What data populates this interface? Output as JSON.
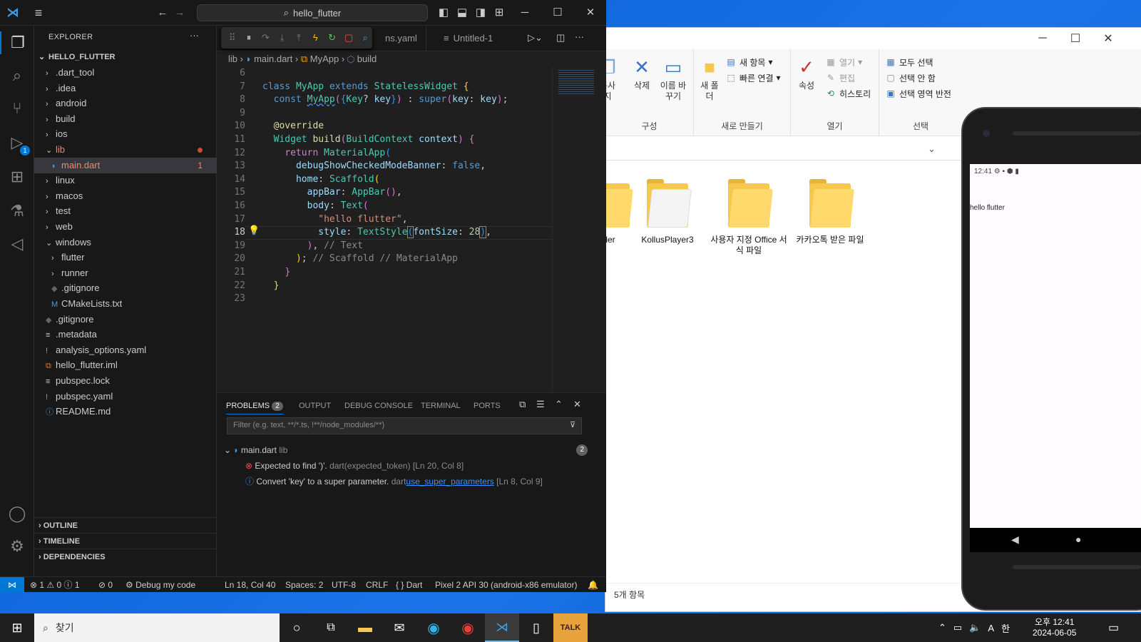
{
  "vscode": {
    "search_text": "hello_flutter",
    "explorer_title": "EXPLORER",
    "project": "HELLO_FLUTTER",
    "tree": [
      {
        "label": ".dart_tool",
        "type": "folder",
        "depth": 1,
        "open": false
      },
      {
        "label": ".idea",
        "type": "folder",
        "depth": 1,
        "open": false
      },
      {
        "label": "android",
        "type": "folder",
        "depth": 1,
        "open": false
      },
      {
        "label": "build",
        "type": "folder",
        "depth": 1,
        "open": false
      },
      {
        "label": "ios",
        "type": "folder",
        "depth": 1,
        "open": false
      },
      {
        "label": "lib",
        "type": "folder",
        "depth": 1,
        "open": true,
        "error": true
      },
      {
        "label": "main.dart",
        "type": "dart",
        "depth": 2,
        "selected": true,
        "badge": "1"
      },
      {
        "label": "linux",
        "type": "folder",
        "depth": 1,
        "open": false
      },
      {
        "label": "macos",
        "type": "folder",
        "depth": 1,
        "open": false
      },
      {
        "label": "test",
        "type": "folder",
        "depth": 1,
        "open": false
      },
      {
        "label": "web",
        "type": "folder",
        "depth": 1,
        "open": false
      },
      {
        "label": "windows",
        "type": "folder",
        "depth": 1,
        "open": true
      },
      {
        "label": "flutter",
        "type": "folder",
        "depth": 2,
        "open": false
      },
      {
        "label": "runner",
        "type": "folder",
        "depth": 2,
        "open": false
      },
      {
        "label": ".gitignore",
        "type": "git",
        "depth": 2
      },
      {
        "label": "CMakeLists.txt",
        "type": "cmake",
        "depth": 2
      },
      {
        "label": ".gitignore",
        "type": "git",
        "depth": 1
      },
      {
        "label": ".metadata",
        "type": "text",
        "depth": 1
      },
      {
        "label": "analysis_options.yaml",
        "type": "yaml",
        "depth": 1
      },
      {
        "label": "hello_flutter.iml",
        "type": "xml",
        "depth": 1
      },
      {
        "label": "pubspec.lock",
        "type": "text",
        "depth": 1
      },
      {
        "label": "pubspec.yaml",
        "type": "yaml",
        "depth": 1
      },
      {
        "label": "README.md",
        "type": "info",
        "depth": 1
      }
    ],
    "sections": [
      "OUTLINE",
      "TIMELINE",
      "DEPENDENCIES"
    ],
    "tabs": [
      {
        "label": "ns.yaml",
        "icon": "!"
      },
      {
        "label": "Untitled-1",
        "icon": "≡"
      }
    ],
    "breadcrumb": [
      "lib",
      "main.dart",
      "MyApp",
      "build"
    ],
    "line_numbers": [
      "6",
      "7",
      "8",
      "9",
      "10",
      "11",
      "12",
      "13",
      "14",
      "15",
      "16",
      "17",
      "18",
      "19",
      "20",
      "21",
      "22",
      "23"
    ],
    "current_line": "18",
    "panel": {
      "tabs": [
        "PROBLEMS",
        "OUTPUT",
        "DEBUG CONSOLE",
        "TERMINAL",
        "PORTS"
      ],
      "problems_count": "2",
      "filter_placeholder": "Filter (e.g. text, **/*.ts, !**/node_modules/**)",
      "file": "main.dart",
      "file_dir": "lib",
      "file_count": "2",
      "items": [
        {
          "severity": "error",
          "message": "Expected to find ')'.",
          "source": "dart(expected_token)",
          "link": "",
          "loc": "[Ln 20, Col 8]"
        },
        {
          "severity": "info",
          "message": "Convert 'key' to a super parameter.",
          "source": "dart",
          "link": "use_super_parameters",
          "loc": "[Ln 8, Col 9]"
        }
      ]
    },
    "status": {
      "errors": "1",
      "warnings": "0",
      "infos": "1",
      "ports": "0",
      "debug": "Debug my code",
      "position": "Ln 18, Col 40",
      "spaces": "Spaces: 2",
      "encoding": "UTF-8",
      "eol": "CRLF",
      "language": "Dart",
      "device": "Pixel 2 API 30 (android-x86 emulator)"
    }
  },
  "explorer_window": {
    "ribbon": {
      "copy": "복사",
      "copy2": "지",
      "delete": "삭제",
      "rename": "이름 바꾸기",
      "new_folder": "새 폴더",
      "new_item": "새 항목",
      "easy_access": "빠른 연결",
      "properties": "속성",
      "open": "열기",
      "edit": "편집",
      "history": "히스토리",
      "select_all": "모두 선택",
      "select_none": "선택 안 함",
      "invert": "선택 영역 반전",
      "group_organize": "구성",
      "group_new": "새로 만들기",
      "group_open": "열기",
      "group_select": "선택"
    },
    "folders": [
      "der",
      "KollusPlayer3",
      "사용자 지정 Office 서식 파일",
      "카카오톡 받은 파일"
    ],
    "status": "5개 항목"
  },
  "phone": {
    "time": "12:41",
    "text": "hello flutter"
  },
  "taskbar": {
    "search": "찾기",
    "ime": "A",
    "ime2": "한",
    "time": "오후 12:41",
    "date": "2024-06-05"
  }
}
